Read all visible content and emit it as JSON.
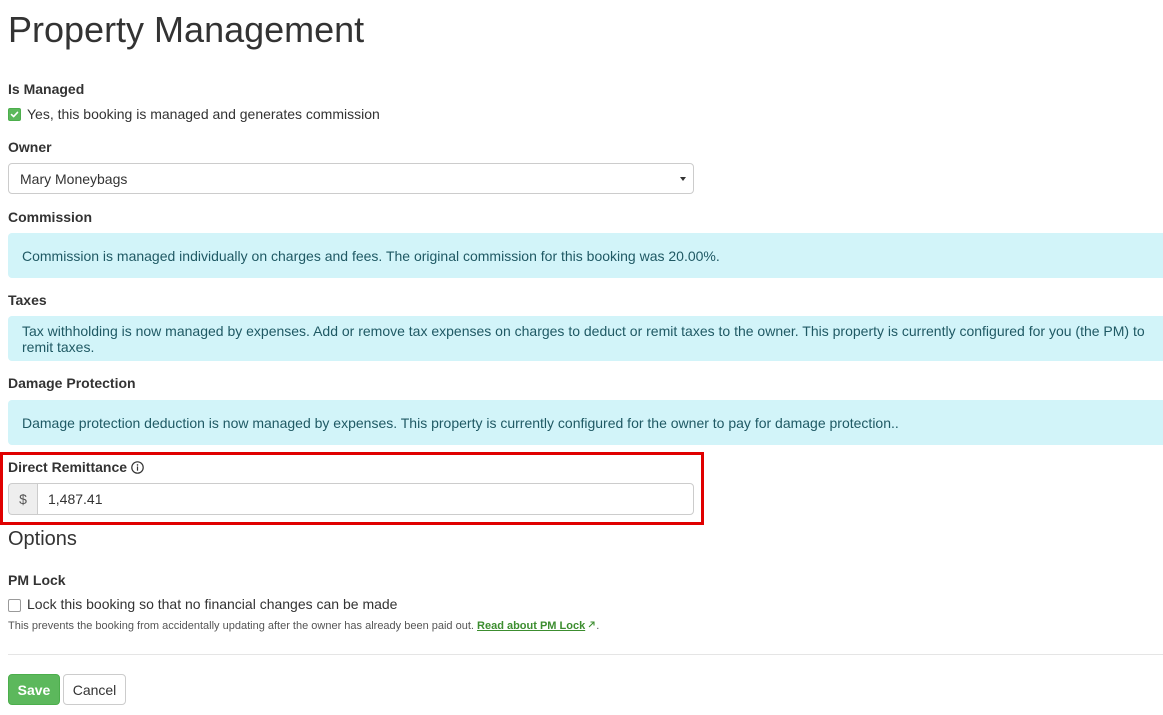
{
  "page": {
    "title": "Property Management"
  },
  "is_managed": {
    "label": "Is Managed",
    "checkbox_label": "Yes, this booking is managed and generates commission",
    "checked": true
  },
  "owner": {
    "label": "Owner",
    "selected": "Mary Moneybags"
  },
  "commission": {
    "label": "Commission",
    "message": "Commission is managed individually on charges and fees. The original commission for this booking was 20.00%."
  },
  "taxes": {
    "label": "Taxes",
    "message": "Tax withholding is now managed by expenses. Add or remove tax expenses on charges to deduct or remit taxes to the owner. This property is currently configured for you (the PM) to remit taxes."
  },
  "damage_protection": {
    "label": "Damage Protection",
    "message": "Damage protection deduction is now managed by expenses. This property is currently configured for the owner to pay for damage protection.."
  },
  "direct_remittance": {
    "label": "Direct Remittance",
    "currency_symbol": "$",
    "value": "1,487.41"
  },
  "options": {
    "title": "Options",
    "pm_lock": {
      "label": "PM Lock",
      "checkbox_label": "Lock this booking so that no financial changes can be made",
      "checked": false,
      "help_text": "This prevents the booking from accidentally updating after the owner has already been paid out.",
      "link_text": "Read about PM Lock",
      "trailing": "."
    }
  },
  "actions": {
    "save_label": "Save",
    "cancel_label": "Cancel"
  },
  "colors": {
    "primary_green": "#5cb85c",
    "info_bg": "#d2f4f9",
    "info_text": "#1f5964",
    "highlight_border": "#e00000"
  }
}
